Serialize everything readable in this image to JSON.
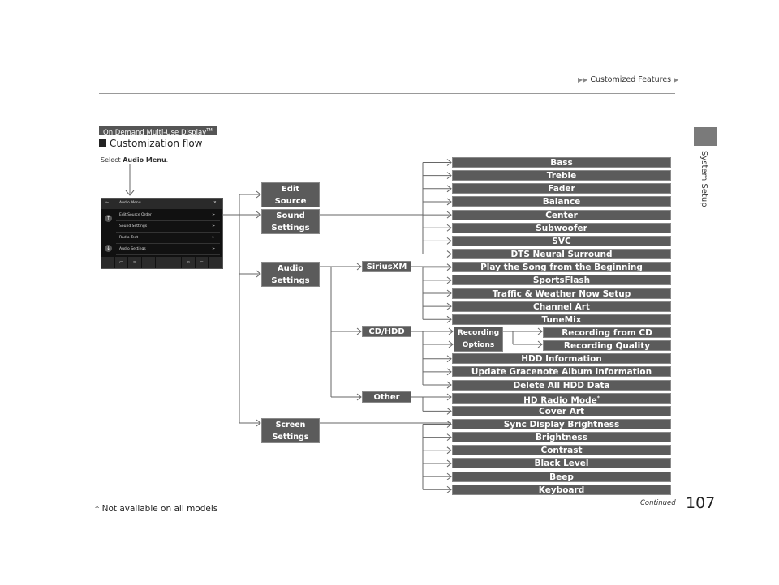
{
  "header": {
    "breadcrumb": "Customized Features",
    "section_side_label": "System Setup",
    "page_number": "107",
    "continued_label": "Continued"
  },
  "intro": {
    "section_tag": "On Demand Multi-Use Display",
    "section_tag_tm": "TM",
    "heading": "Customization flow",
    "select_prefix": "Select ",
    "select_bold": "Audio Menu",
    "select_suffix": "."
  },
  "screen": {
    "title": "Audio Menu",
    "rows": [
      {
        "label": "Edit Source Order",
        "arrow": ">"
      },
      {
        "label": "Sound Settings",
        "arrow": ">"
      },
      {
        "label": "Radio Text",
        "arrow": ">"
      },
      {
        "label": "Audio Settings",
        "arrow": ">"
      }
    ],
    "close": "✕",
    "back": "⇦"
  },
  "flow": {
    "level1": {
      "edit_source_order": "Edit Source Order",
      "sound_settings": "Sound Settings",
      "audio_settings": "Audio Settings",
      "screen_settings": "Screen Settings"
    },
    "level2": {
      "siriusxm": "SiriusXM",
      "cdhdd": "CD/HDD",
      "other": "Other",
      "recording_options": "Recording Options"
    },
    "sound_items": [
      "Bass",
      "Treble",
      "Fader",
      "Balance",
      "Center",
      "Subwoofer",
      "SVC",
      "DTS Neural Surround"
    ],
    "siriusxm_items": [
      "Play the Song from the Beginning",
      "SportsFlash",
      "Traffic & Weather Now Setup",
      "Channel Art",
      "TuneMix"
    ],
    "recording_items": [
      "Recording from CD",
      "Recording Quality"
    ],
    "cdhdd_items": [
      "HDD Information",
      "Update Gracenote Album Information",
      "Delete All HDD Data"
    ],
    "other_items": [
      "HD Radio Mode",
      "Cover Art"
    ],
    "other_item_note": "*",
    "screen_items": [
      "Sync Display Brightness",
      "Brightness",
      "Contrast",
      "Black Level",
      "Beep",
      "Keyboard"
    ]
  },
  "footnote": "* Not available on all models"
}
